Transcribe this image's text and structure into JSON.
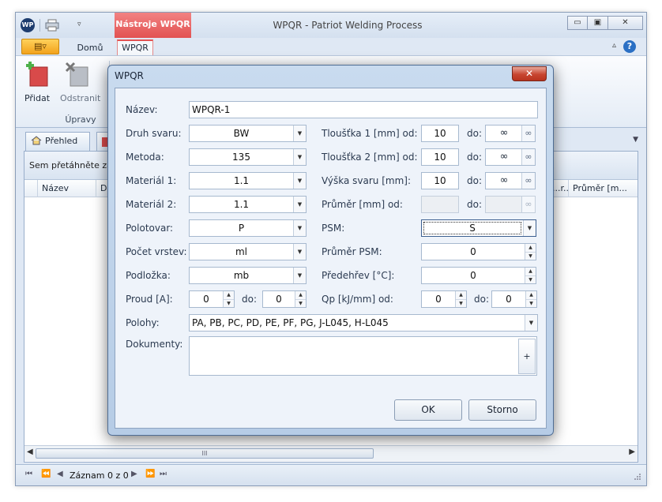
{
  "window": {
    "logo_text": "WP",
    "title": "WPQR - Patriot Welding Process",
    "context_tab_header": "Nástroje WPQR",
    "controls": {
      "minimize": "▭",
      "restore": "▣",
      "close": "✕"
    }
  },
  "ribbon": {
    "tabs": [
      {
        "label": "Domů"
      },
      {
        "label": "WPQR"
      }
    ],
    "buttons": [
      {
        "label": "Přidat"
      },
      {
        "label": "Odstranit"
      }
    ],
    "group_label": "Úpravy",
    "help": "?",
    "collapse": "▵"
  },
  "workspace": {
    "doc_tab": "Přehled",
    "group_panel_text": "Sem přetáhněte zá",
    "columns": [
      "Název",
      "D",
      "...r...",
      "Průměr [m..."
    ],
    "scroll_grip": "III",
    "status": {
      "record_text": "Záznam 0 z 0"
    }
  },
  "dialog": {
    "title": "WPQR",
    "close": "✕",
    "fields": {
      "nazev": {
        "label": "Název:",
        "value": "WPQR-1"
      },
      "druh_svaru": {
        "label": "Druh svaru:",
        "value": "BW"
      },
      "metoda": {
        "label": "Metoda:",
        "value": "135"
      },
      "material1": {
        "label": "Materiál 1:",
        "value": "1.1"
      },
      "material2": {
        "label": "Materiál 2:",
        "value": "1.1"
      },
      "polotovar": {
        "label": "Polotovar:",
        "value": "P"
      },
      "pocet_vrstev": {
        "label": "Počet vrstev:",
        "value": "ml"
      },
      "podlozka": {
        "label": "Podložka:",
        "value": "mb"
      },
      "proud": {
        "label": "Proud [A]:",
        "from": "0",
        "to_label": "do:",
        "to": "0"
      },
      "tloustka1": {
        "label": "Tloušťka 1 [mm] od:",
        "from": "10",
        "to_label": "do:",
        "to": "∞"
      },
      "tloustka2": {
        "label": "Tloušťka 2 [mm] od:",
        "from": "10",
        "to_label": "do:",
        "to": "∞"
      },
      "vyska_svaru": {
        "label": "Výška svaru [mm]:",
        "from": "10",
        "to_label": "do:",
        "to": "∞"
      },
      "prumer": {
        "label": "Průměr [mm] od:",
        "from": "",
        "to_label": "do:",
        "to": ""
      },
      "psm": {
        "label": "PSM:",
        "value": "S"
      },
      "prumer_psm": {
        "label": "Průměr PSM:",
        "value": "0"
      },
      "predehrev": {
        "label": "Předehřev [°C]:",
        "value": "0"
      },
      "qp": {
        "label": "Qp [kJ/mm] od:",
        "from": "0",
        "to_label": "do:",
        "to": "0"
      },
      "polohy": {
        "label": "Polohy:",
        "value": "PA, PB, PC, PD, PE, PF, PG, J-L045, H-L045"
      },
      "dokumenty": {
        "label": "Dokumenty:",
        "add": "+"
      }
    },
    "infinity_toggle": "∞",
    "buttons": {
      "ok": "OK",
      "cancel": "Storno"
    }
  }
}
